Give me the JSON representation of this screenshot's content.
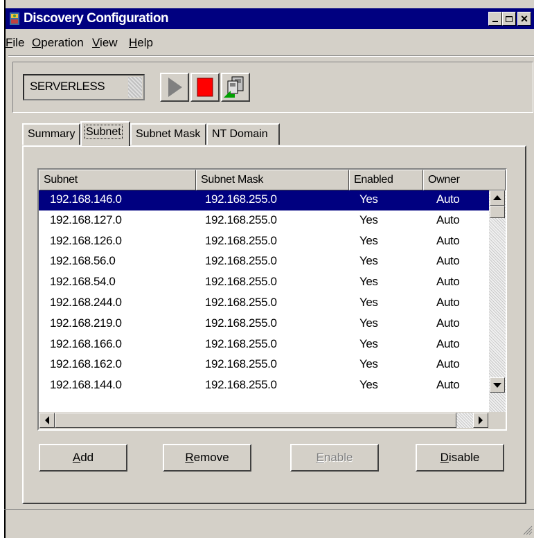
{
  "window": {
    "title": "Discovery Configuration",
    "controls": [
      "minimize-icon",
      "restore-icon",
      "close-icon"
    ],
    "colors": {
      "titlebar": "#000080",
      "face": "#d4d0c8",
      "selection": "#000080"
    }
  },
  "menu": {
    "items": [
      {
        "label": "File",
        "accel": "F",
        "rest": "ile"
      },
      {
        "label": "Operation",
        "accel": "O",
        "rest": "peration"
      },
      {
        "label": "View",
        "accel": "V",
        "rest": "iew"
      },
      {
        "label": "Help",
        "accel": "H",
        "rest": "elp"
      }
    ]
  },
  "toolbar": {
    "server": "SERVERLESS",
    "buttons": [
      "play-icon",
      "stop-icon",
      "computers-icon"
    ]
  },
  "tabs": [
    {
      "label": "Summary"
    },
    {
      "label": "Subnet",
      "active": true
    },
    {
      "label": "Subnet Mask"
    },
    {
      "label": "NT Domain"
    }
  ],
  "table": {
    "columns": [
      "Subnet",
      "Subnet Mask",
      "Enabled",
      "Owner"
    ],
    "rows": [
      {
        "subnet": "192.168.146.0",
        "mask": "192.168.255.0",
        "enabled": "Yes",
        "owner": "Auto"
      },
      {
        "subnet": "192.168.127.0",
        "mask": "192.168.255.0",
        "enabled": "Yes",
        "owner": "Auto"
      },
      {
        "subnet": "192.168.126.0",
        "mask": "192.168.255.0",
        "enabled": "Yes",
        "owner": "Auto"
      },
      {
        "subnet": "192.168.56.0",
        "mask": "192.168.255.0",
        "enabled": "Yes",
        "owner": "Auto"
      },
      {
        "subnet": "192.168.54.0",
        "mask": "192.168.255.0",
        "enabled": "Yes",
        "owner": "Auto"
      },
      {
        "subnet": "192.168.244.0",
        "mask": "192.168.255.0",
        "enabled": "Yes",
        "owner": "Auto"
      },
      {
        "subnet": "192.168.219.0",
        "mask": "192.168.255.0",
        "enabled": "Yes",
        "owner": "Auto"
      },
      {
        "subnet": "192.168.166.0",
        "mask": "192.168.255.0",
        "enabled": "Yes",
        "owner": "Auto"
      },
      {
        "subnet": "192.168.162.0",
        "mask": "192.168.255.0",
        "enabled": "Yes",
        "owner": "Auto"
      },
      {
        "subnet": "192.168.144.0",
        "mask": "192.168.255.0",
        "enabled": "Yes",
        "owner": "Auto"
      }
    ],
    "selected_index": 0
  },
  "actions": {
    "add": {
      "accel": "A",
      "rest": "dd"
    },
    "remove": {
      "accel": "R",
      "rest": "emove"
    },
    "enable": {
      "accel": "E",
      "rest": "nable",
      "disabled": true
    },
    "disable": {
      "accel": "D",
      "rest": "isable"
    }
  }
}
